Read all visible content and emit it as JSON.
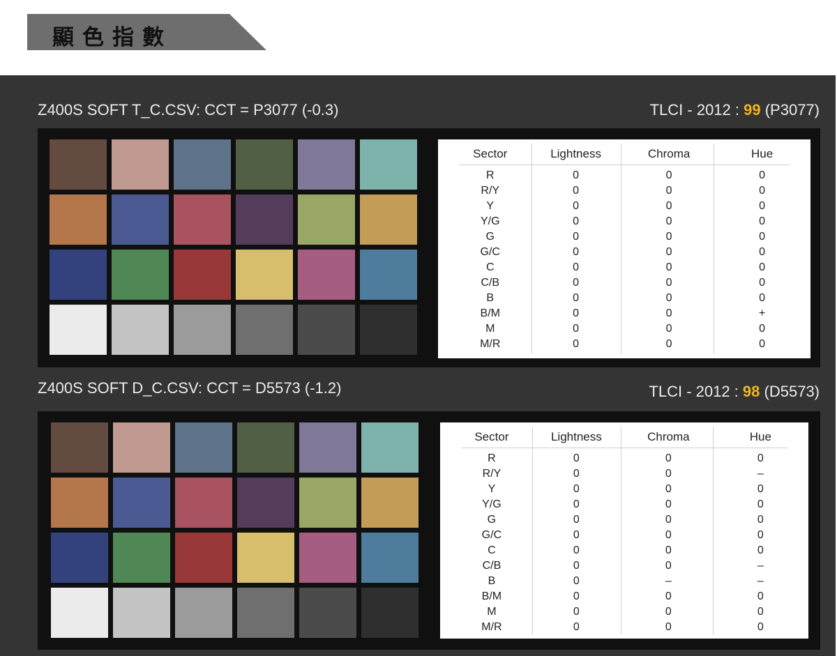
{
  "title": "顯色指數",
  "colors": {
    "panel": "#343434",
    "score": "#f2b519",
    "text": "#ececec"
  },
  "columns": [
    "Sector",
    "Lightness",
    "Chroma",
    "Hue"
  ],
  "patch_colors": [
    "#644b40",
    "#c09a91",
    "#5e7289",
    "#515f45",
    "#807899",
    "#7eb3ab",
    "#b4764b",
    "#4b5a92",
    "#aa5360",
    "#533d5b",
    "#99a766",
    "#c39c58",
    "#33427c",
    "#4f8755",
    "#993839",
    "#d6be6c",
    "#a65d82",
    "#4e7c9c",
    "#ebebeb",
    "#c4c4c4",
    "#9b9b9b",
    "#6f6f6f",
    "#4b4b4b",
    "#2f2f2f"
  ],
  "measurements": [
    {
      "file_line": "Z400S SOFT T_C.CSV: CCT = P3077 (-0.3)",
      "tlci_label": "TLCI - 2012 : ",
      "tlci_score": "99",
      "tlci_ref": " (P3077)",
      "rows": [
        {
          "sector": "R",
          "lightness": "0",
          "chroma": "0",
          "hue": "0"
        },
        {
          "sector": "R/Y",
          "lightness": "0",
          "chroma": "0",
          "hue": "0"
        },
        {
          "sector": "Y",
          "lightness": "0",
          "chroma": "0",
          "hue": "0"
        },
        {
          "sector": "Y/G",
          "lightness": "0",
          "chroma": "0",
          "hue": "0"
        },
        {
          "sector": "G",
          "lightness": "0",
          "chroma": "0",
          "hue": "0"
        },
        {
          "sector": "G/C",
          "lightness": "0",
          "chroma": "0",
          "hue": "0"
        },
        {
          "sector": "C",
          "lightness": "0",
          "chroma": "0",
          "hue": "0"
        },
        {
          "sector": "C/B",
          "lightness": "0",
          "chroma": "0",
          "hue": "0"
        },
        {
          "sector": "B",
          "lightness": "0",
          "chroma": "0",
          "hue": "0"
        },
        {
          "sector": "B/M",
          "lightness": "0",
          "chroma": "0",
          "hue": "+"
        },
        {
          "sector": "M",
          "lightness": "0",
          "chroma": "0",
          "hue": "0"
        },
        {
          "sector": "M/R",
          "lightness": "0",
          "chroma": "0",
          "hue": "0"
        }
      ]
    },
    {
      "file_line": "Z400S SOFT D_C.CSV: CCT = D5573 (-1.2)",
      "tlci_label": "TLCI - 2012 : ",
      "tlci_score": "98",
      "tlci_ref": " (D5573)",
      "rows": [
        {
          "sector": "R",
          "lightness": "0",
          "chroma": "0",
          "hue": "0"
        },
        {
          "sector": "R/Y",
          "lightness": "0",
          "chroma": "0",
          "hue": "–"
        },
        {
          "sector": "Y",
          "lightness": "0",
          "chroma": "0",
          "hue": "0"
        },
        {
          "sector": "Y/G",
          "lightness": "0",
          "chroma": "0",
          "hue": "0"
        },
        {
          "sector": "G",
          "lightness": "0",
          "chroma": "0",
          "hue": "0"
        },
        {
          "sector": "G/C",
          "lightness": "0",
          "chroma": "0",
          "hue": "0"
        },
        {
          "sector": "C",
          "lightness": "0",
          "chroma": "0",
          "hue": "0"
        },
        {
          "sector": "C/B",
          "lightness": "0",
          "chroma": "0",
          "hue": "–"
        },
        {
          "sector": "B",
          "lightness": "0",
          "chroma": "–",
          "hue": "–"
        },
        {
          "sector": "B/M",
          "lightness": "0",
          "chroma": "0",
          "hue": "0"
        },
        {
          "sector": "M",
          "lightness": "0",
          "chroma": "0",
          "hue": "0"
        },
        {
          "sector": "M/R",
          "lightness": "0",
          "chroma": "0",
          "hue": "0"
        }
      ]
    }
  ]
}
